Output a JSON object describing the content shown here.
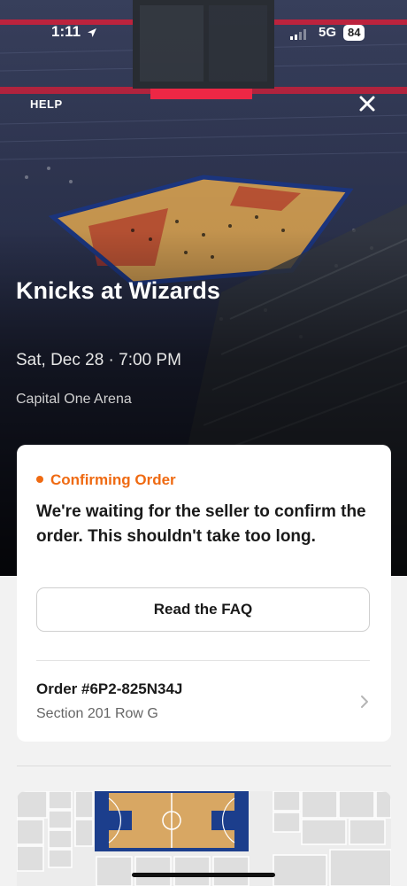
{
  "status_bar": {
    "time": "1:11",
    "network": "5G",
    "battery": "84"
  },
  "header": {
    "help_label": "HELP",
    "close_icon": "close-icon"
  },
  "event": {
    "title": "Knicks at Wizards",
    "date": "Sat, Dec 28 · 7:00 PM",
    "venue": "Capital One Arena"
  },
  "order_status": {
    "label": "Confirming Order",
    "message": "We're waiting for the seller to confirm the order. This shouldn't take too long.",
    "faq_button_label": "Read the FAQ",
    "accent_color": "#ef6a12"
  },
  "order": {
    "number": "Order #6P2-825N34J",
    "seat": "Section 201 Row G",
    "chevron_icon": "chevron-right-icon"
  },
  "seat_map": {
    "icon": "seat-map-image"
  }
}
